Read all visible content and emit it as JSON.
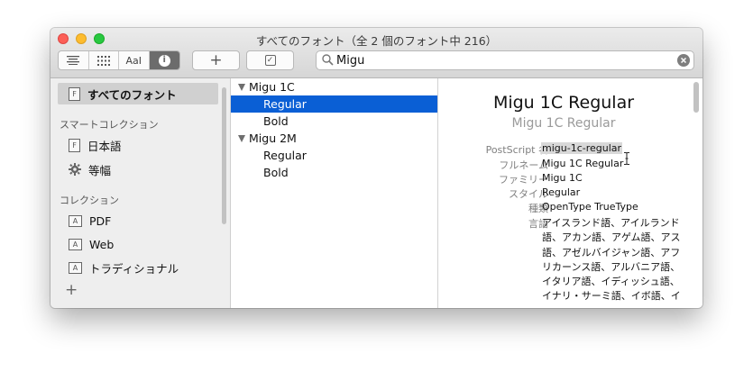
{
  "window": {
    "title": "すべてのフォント（全 2 個のフォント中 216）"
  },
  "toolbar": {
    "view_buttons": [
      "list-view-icon",
      "grid-view-icon",
      "sample-view-icon",
      "info-view-icon"
    ],
    "sample_label": "AaI",
    "info_glyph": "i",
    "add_label": "+",
    "check_label": "✓"
  },
  "search": {
    "value": "Migu",
    "placeholder": ""
  },
  "sidebar": {
    "library": {
      "label": "すべてのフォント",
      "badge": "F"
    },
    "smart_header": "スマートコレクション",
    "smart_items": [
      {
        "label": "日本語",
        "badge": "F",
        "icon": "font-collection-icon"
      },
      {
        "label": "等幅",
        "icon": "gear-icon"
      }
    ],
    "collection_header": "コレクション",
    "collection_items": [
      {
        "label": "PDF",
        "badge": "A"
      },
      {
        "label": "Web",
        "badge": "A"
      },
      {
        "label": "トラディショナル",
        "badge": "A"
      }
    ],
    "add_label": "+"
  },
  "fontlist": {
    "families": [
      {
        "name": "Migu 1C",
        "faces": [
          "Regular",
          "Bold"
        ]
      },
      {
        "name": "Migu 2M",
        "faces": [
          "Regular",
          "Bold"
        ]
      }
    ],
    "selected": "Migu 1C / Regular"
  },
  "detail": {
    "title": "Migu 1C Regular",
    "subtitle": "Migu 1C Regular",
    "fields": [
      {
        "label": "PostScript 名",
        "value": "migu-1c-regular"
      },
      {
        "label": "フルネーム",
        "value": "Migu 1C Regular"
      },
      {
        "label": "ファミリー",
        "value": "Migu 1C"
      },
      {
        "label": "スタイル",
        "value": "Regular"
      },
      {
        "label": "種類",
        "value": "OpenType TrueType"
      },
      {
        "label": "言語",
        "value": "アイスランド語、アイルランド語、アカン語、アゲム語、アス語、アゼルバイジャン語、アフリカーンス語、アルバニア語、イタリア語、イディッシュ語、イナリ・サーミ語、イボ語、イ"
      }
    ]
  },
  "colors": {
    "selection": "#0a5fd5",
    "sidebar_selection": "#d0d0d0"
  }
}
